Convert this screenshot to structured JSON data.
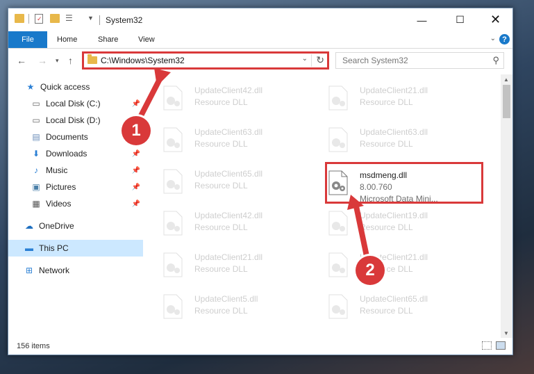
{
  "window": {
    "title": "System32"
  },
  "ribbon": {
    "file": "File",
    "home": "Home",
    "share": "Share",
    "view": "View"
  },
  "address": {
    "path": "C:\\Windows\\System32"
  },
  "search": {
    "placeholder": "Search System32"
  },
  "nav": [
    {
      "label": "Quick access",
      "icon": "star-icon"
    },
    {
      "label": "Local Disk (C:)",
      "icon": "drive-icon",
      "pinned": true
    },
    {
      "label": "Local Disk (D:)",
      "icon": "drive-icon"
    },
    {
      "label": "Documents",
      "icon": "documents-icon"
    },
    {
      "label": "Downloads",
      "icon": "download-icon",
      "pinned": true
    },
    {
      "label": "Music",
      "icon": "music-icon",
      "pinned": true
    },
    {
      "label": "Pictures",
      "icon": "pictures-icon",
      "pinned": true
    },
    {
      "label": "Videos",
      "icon": "videos-icon",
      "pinned": true
    },
    {
      "label": "OneDrive",
      "icon": "cloud-icon"
    },
    {
      "label": "This PC",
      "icon": "computer-icon",
      "selected": true
    },
    {
      "label": "Network",
      "icon": "network-icon"
    }
  ],
  "files": {
    "left": [
      {
        "name": "UpdateClient42.dll",
        "desc": "Resource DLL"
      },
      {
        "name": "UpdateClient63.dll",
        "desc": "Resource DLL"
      },
      {
        "name": "UpdateClient65.dll",
        "desc": "Resource DLL"
      },
      {
        "name": "UpdateClient42.dll",
        "desc": "Resource DLL"
      },
      {
        "name": "UpdateClient21.dll",
        "desc": "Resource DLL"
      },
      {
        "name": "UpdateClient5.dll",
        "desc": "Resource DLL"
      }
    ],
    "right": [
      {
        "name": "UpdateClient21.dll",
        "desc": "Resource DLL"
      },
      {
        "name": "UpdateClient63.dll",
        "desc": "Resource DLL"
      },
      {
        "name": "msdmeng.dll",
        "version": "8.00.760",
        "desc": "Microsoft Data Mini..."
      },
      {
        "name": "UpdateClient19.dll",
        "desc": "Resource DLL"
      },
      {
        "name": "UpdateClient21.dll",
        "desc": "Resource DLL"
      },
      {
        "name": "UpdateClient65.dll",
        "desc": "Resource DLL"
      }
    ]
  },
  "status": {
    "count": "156 items"
  },
  "callouts": {
    "one": "1",
    "two": "2"
  },
  "colors": {
    "highlight": "#d9393a",
    "accent": "#1979ca"
  }
}
